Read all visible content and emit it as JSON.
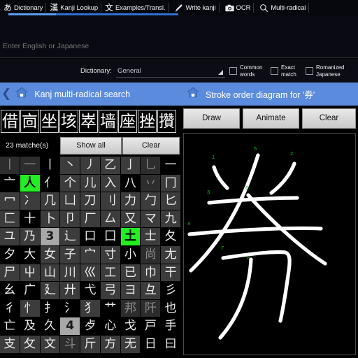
{
  "tabs": [
    {
      "icon": "hiragana-a-icon",
      "glyph": "あ",
      "label": "Dictionary",
      "active": true
    },
    {
      "icon": "kanji-kan-icon",
      "glyph": "漢",
      "label": "Kanji Lookup",
      "active": false
    },
    {
      "icon": "kanji-bun-icon",
      "glyph": "文",
      "label": "Examples/Transl.",
      "active": false
    },
    {
      "icon": "pen-icon",
      "glyph": "",
      "label": "Write kanji",
      "active": false
    },
    {
      "icon": "camera-icon",
      "glyph": "",
      "label": "OCR",
      "active": false
    },
    {
      "icon": "magnifier-icon",
      "glyph": "",
      "label": "Multi-radical",
      "active": false
    }
  ],
  "search": {
    "value": "",
    "placeholder": "Enter English or Japanese"
  },
  "options": {
    "dictionary_label": "Dictionary:",
    "dictionary_value": "General",
    "dictionary_options": [
      "General"
    ],
    "checkboxes": [
      {
        "name": "common-words",
        "label": "Common\nwords",
        "line1": "Common",
        "line2": "words",
        "checked": false
      },
      {
        "name": "exact-match",
        "label": "Exact match",
        "line1": "Exact",
        "line2": "match",
        "checked": false
      },
      {
        "name": "romanized-japanese",
        "label": "Romanized Japanese",
        "line1": "Romanized",
        "line2": "Japanese",
        "checked": false
      }
    ]
  },
  "left_panel": {
    "header_title": "Kanj multi-radical search",
    "back_icon": "back-chevron-icon",
    "home_icon": "home-icon",
    "results": [
      "借",
      "㐭",
      "坐",
      "垓",
      "崒",
      "墙",
      "座",
      "挫",
      "攢"
    ],
    "match_count": "23 matche(s)",
    "show_all_label": "Show all",
    "clear_label": "Clear",
    "radicals": [
      {
        "g": "丨",
        "s": "disabled"
      },
      {
        "g": "一",
        "s": "disabled"
      },
      {
        "g": "丨",
        "s": "dark"
      },
      {
        "g": "丶",
        "s": "normal"
      },
      {
        "g": "丿",
        "s": "normal"
      },
      {
        "g": "乙",
        "s": "normal"
      },
      {
        "g": "亅",
        "s": "normal"
      },
      {
        "g": "乚",
        "s": "disabled"
      },
      {
        "g": "一",
        "s": "dark"
      },
      {
        "g": "亠",
        "s": "dark"
      },
      {
        "g": "人",
        "s": "sel"
      },
      {
        "g": "亻",
        "s": "dark"
      },
      {
        "g": "个",
        "s": "normal"
      },
      {
        "g": "儿",
        "s": "normal"
      },
      {
        "g": "入",
        "s": "normal"
      },
      {
        "g": "八",
        "s": "dark"
      },
      {
        "g": "丷",
        "s": "disabled"
      },
      {
        "g": "冂",
        "s": "normal"
      },
      {
        "g": "冖",
        "s": "normal"
      },
      {
        "g": "冫",
        "s": "normal"
      },
      {
        "g": "几",
        "s": "normal"
      },
      {
        "g": "凵",
        "s": "normal"
      },
      {
        "g": "刀",
        "s": "normal"
      },
      {
        "g": "刂",
        "s": "normal"
      },
      {
        "g": "力",
        "s": "normal"
      },
      {
        "g": "勹",
        "s": "normal"
      },
      {
        "g": "匕",
        "s": "normal"
      },
      {
        "g": "匚",
        "s": "normal"
      },
      {
        "g": "十",
        "s": "dark"
      },
      {
        "g": "卜",
        "s": "normal"
      },
      {
        "g": "卩",
        "s": "normal"
      },
      {
        "g": "厂",
        "s": "normal"
      },
      {
        "g": "厶",
        "s": "normal"
      },
      {
        "g": "又",
        "s": "normal"
      },
      {
        "g": "マ",
        "s": "normal"
      },
      {
        "g": "九",
        "s": "normal"
      },
      {
        "g": "ユ",
        "s": "normal"
      },
      {
        "g": "乃",
        "s": "normal"
      },
      {
        "g": "3",
        "s": "header"
      },
      {
        "g": "辶",
        "s": "normal"
      },
      {
        "g": "口",
        "s": "dark"
      },
      {
        "g": "囗",
        "s": "dark"
      },
      {
        "g": "土",
        "s": "sel"
      },
      {
        "g": "士",
        "s": "normal"
      },
      {
        "g": "夂",
        "s": "dark"
      },
      {
        "g": "夕",
        "s": "dark"
      },
      {
        "g": "大",
        "s": "dark"
      },
      {
        "g": "女",
        "s": "normal"
      },
      {
        "g": "子",
        "s": "normal"
      },
      {
        "g": "宀",
        "s": "normal"
      },
      {
        "g": "寸",
        "s": "normal"
      },
      {
        "g": "小",
        "s": "dark"
      },
      {
        "g": "尚",
        "s": "disabled"
      },
      {
        "g": "尢",
        "s": "normal"
      },
      {
        "g": "尸",
        "s": "normal"
      },
      {
        "g": "屮",
        "s": "normal"
      },
      {
        "g": "山",
        "s": "normal"
      },
      {
        "g": "川",
        "s": "normal"
      },
      {
        "g": "巛",
        "s": "normal"
      },
      {
        "g": "工",
        "s": "normal"
      },
      {
        "g": "已",
        "s": "normal"
      },
      {
        "g": "巾",
        "s": "normal"
      },
      {
        "g": "干",
        "s": "normal"
      },
      {
        "g": "幺",
        "s": "dark"
      },
      {
        "g": "广",
        "s": "dark"
      },
      {
        "g": "廴",
        "s": "normal"
      },
      {
        "g": "廾",
        "s": "normal"
      },
      {
        "g": "弋",
        "s": "dark"
      },
      {
        "g": "弓",
        "s": "normal"
      },
      {
        "g": "ヨ",
        "s": "normal"
      },
      {
        "g": "彑",
        "s": "normal"
      },
      {
        "g": "彡",
        "s": "dark"
      },
      {
        "g": "彳",
        "s": "dark"
      },
      {
        "g": "忄",
        "s": "normal"
      },
      {
        "g": "扌",
        "s": "dark"
      },
      {
        "g": "氵",
        "s": "dark"
      },
      {
        "g": "犭",
        "s": "normal"
      },
      {
        "g": "艹",
        "s": "dark"
      },
      {
        "g": "邦",
        "s": "disabled"
      },
      {
        "g": "阡",
        "s": "disabled"
      },
      {
        "g": "也",
        "s": "dark"
      },
      {
        "g": "亡",
        "s": "dark"
      },
      {
        "g": "及",
        "s": "dark"
      },
      {
        "g": "久",
        "s": "dark"
      },
      {
        "g": "4",
        "s": "header"
      },
      {
        "g": "歺",
        "s": "dark"
      },
      {
        "g": "心",
        "s": "dark"
      },
      {
        "g": "戈",
        "s": "dark"
      },
      {
        "g": "戸",
        "s": "dark"
      },
      {
        "g": "手",
        "s": "dark"
      },
      {
        "g": "支",
        "s": "normal"
      },
      {
        "g": "攵",
        "s": "normal"
      },
      {
        "g": "文",
        "s": "normal"
      },
      {
        "g": "斗",
        "s": "disabled"
      },
      {
        "g": "斤",
        "s": "normal"
      },
      {
        "g": "方",
        "s": "normal"
      },
      {
        "g": "无",
        "s": "normal"
      },
      {
        "g": "日",
        "s": "dark"
      },
      {
        "g": "曰",
        "s": "dark"
      }
    ]
  },
  "right_panel": {
    "header_title": "Stroke order diagram for '券'",
    "home_icon": "home-icon",
    "kanji": "券",
    "buttons": {
      "draw": "Draw",
      "animate": "Animate",
      "clear": "Clear"
    },
    "stroke_numbers": [
      "1",
      "2",
      "3",
      "4",
      "5",
      "6",
      "7",
      "8"
    ]
  },
  "colors": {
    "accent_blue": "#5b8bdc",
    "tab_underline": "#2f6fd0",
    "selected_green": "#22ee22",
    "stroke_number_green": "#17c217",
    "panel_bg": "#000000",
    "radical_tile": "#3c3c3c"
  }
}
